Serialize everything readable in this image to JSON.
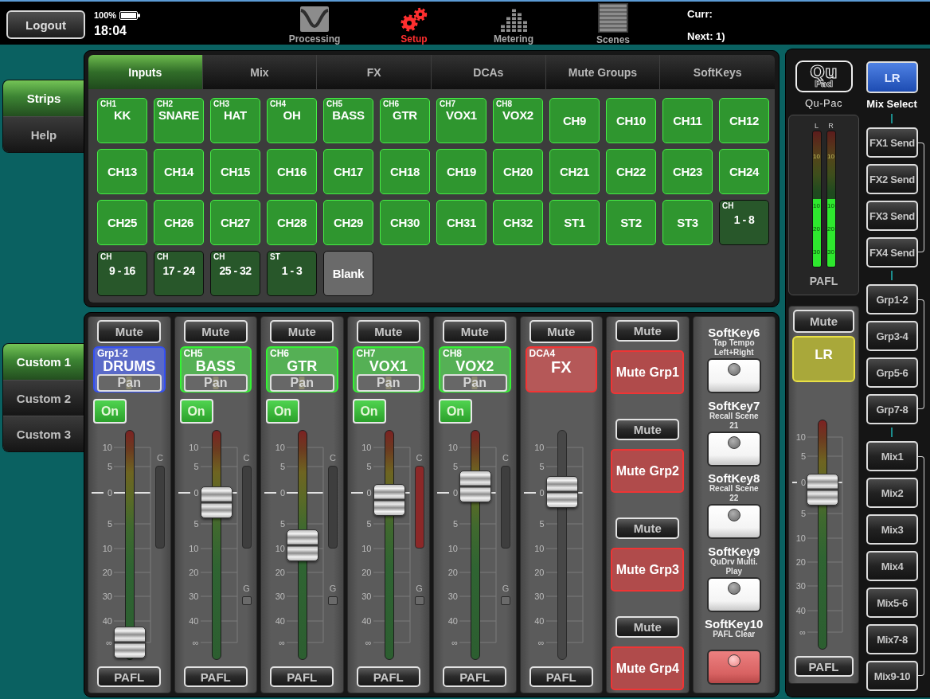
{
  "top_bar": {
    "logout": "Logout",
    "battery": "100%",
    "time": "18:04",
    "nav": [
      {
        "kind": "processing",
        "label": "Processing",
        "selected": false
      },
      {
        "kind": "setup",
        "label": "Setup",
        "selected": true
      },
      {
        "kind": "metering",
        "label": "Metering",
        "selected": false
      },
      {
        "kind": "scenes",
        "label": "Scenes",
        "selected": false
      }
    ],
    "current_scene": "Curr:",
    "next_scene": "Next: 1)"
  },
  "view_tabs": [
    {
      "label": "Strips",
      "selected": true
    },
    {
      "label": "Help",
      "selected": false
    }
  ],
  "layer_tabs": [
    {
      "label": "Custom 1",
      "selected": true
    },
    {
      "label": "Custom 2",
      "selected": false
    },
    {
      "label": "Custom 3",
      "selected": false
    }
  ],
  "setup_tabs": [
    {
      "label": "Inputs",
      "selected": true
    },
    {
      "label": "Mix",
      "selected": false
    },
    {
      "label": "FX",
      "selected": false
    },
    {
      "label": "DCAs",
      "selected": false
    },
    {
      "label": "Mute Groups",
      "selected": false
    },
    {
      "label": "SoftKeys",
      "selected": false
    }
  ],
  "inputs": [
    {
      "kind": "channel",
      "tag": "CH1",
      "name": "KK"
    },
    {
      "kind": "channel",
      "tag": "CH2",
      "name": "SNARE"
    },
    {
      "kind": "channel",
      "tag": "CH3",
      "name": "HAT"
    },
    {
      "kind": "channel",
      "tag": "CH4",
      "name": "OH"
    },
    {
      "kind": "channel",
      "tag": "CH5",
      "name": "BASS"
    },
    {
      "kind": "channel",
      "tag": "CH6",
      "name": "GTR"
    },
    {
      "kind": "channel",
      "tag": "CH7",
      "name": "VOX1"
    },
    {
      "kind": "channel",
      "tag": "CH8",
      "name": "VOX2"
    },
    {
      "kind": "channel",
      "name": "CH9"
    },
    {
      "kind": "channel",
      "name": "CH10"
    },
    {
      "kind": "channel",
      "name": "CH11"
    },
    {
      "kind": "channel",
      "name": "CH12"
    },
    {
      "kind": "channel",
      "name": "CH13"
    },
    {
      "kind": "channel",
      "name": "CH14"
    },
    {
      "kind": "channel",
      "name": "CH15"
    },
    {
      "kind": "channel",
      "name": "CH16"
    },
    {
      "kind": "channel",
      "name": "CH17"
    },
    {
      "kind": "channel",
      "name": "CH18"
    },
    {
      "kind": "channel",
      "name": "CH19"
    },
    {
      "kind": "channel",
      "name": "CH20"
    },
    {
      "kind": "channel",
      "name": "CH21"
    },
    {
      "kind": "channel",
      "name": "CH22"
    },
    {
      "kind": "channel",
      "name": "CH23"
    },
    {
      "kind": "channel",
      "name": "CH24"
    },
    {
      "kind": "channel",
      "name": "CH25"
    },
    {
      "kind": "channel",
      "name": "CH26"
    },
    {
      "kind": "channel",
      "name": "CH27"
    },
    {
      "kind": "channel",
      "name": "CH28"
    },
    {
      "kind": "channel",
      "name": "CH29"
    },
    {
      "kind": "channel",
      "name": "CH30"
    },
    {
      "kind": "channel",
      "name": "CH31"
    },
    {
      "kind": "channel",
      "name": "CH32"
    },
    {
      "kind": "channel",
      "name": "ST1"
    },
    {
      "kind": "channel",
      "name": "ST2"
    },
    {
      "kind": "channel",
      "name": "ST3"
    },
    {
      "kind": "bank",
      "tag": "CH",
      "name": "1 - 8"
    },
    {
      "kind": "bank",
      "tag": "CH",
      "name": "9 - 16"
    },
    {
      "kind": "bank",
      "tag": "CH",
      "name": "17 - 24"
    },
    {
      "kind": "bank",
      "tag": "CH",
      "name": "25 - 32"
    },
    {
      "kind": "bank",
      "tag": "ST",
      "name": "1 - 3"
    },
    {
      "kind": "blank",
      "name": "Blank"
    }
  ],
  "strips": [
    {
      "kind": "channel",
      "mute": "Mute",
      "muted": false,
      "tag": "Grp1-2",
      "name": "DRUMS",
      "color": "#5a6ac8",
      "pan": {
        "label": "Pan",
        "level": 0.5
      },
      "on_button": {
        "label": "On",
        "on": true
      },
      "fader": {
        "level": 0,
        "scale": [
          "10",
          "5",
          "0",
          "5",
          "10",
          "20",
          "30",
          "40",
          "∞"
        ]
      },
      "comp": {
        "label": "C",
        "active": false
      },
      "pafl": "PAFL"
    },
    {
      "kind": "channel",
      "mute": "Mute",
      "muted": false,
      "tag": "CH5",
      "name": "BASS",
      "color": "#55b055",
      "pan": {
        "label": "Pan",
        "level": 0.5
      },
      "on_button": {
        "label": "On",
        "on": true
      },
      "fader": {
        "level": 0.72,
        "scale": [
          "10",
          "5",
          "0",
          "5",
          "10",
          "20",
          "30",
          "40",
          "∞"
        ]
      },
      "comp": {
        "label": "C",
        "active": false
      },
      "gate": "G",
      "pafl": "PAFL"
    },
    {
      "kind": "channel",
      "mute": "Mute",
      "muted": false,
      "tag": "CH6",
      "name": "GTR",
      "color": "#55b055",
      "pan": {
        "label": "Pan",
        "level": 0.5
      },
      "on_button": {
        "label": "On",
        "on": true
      },
      "fader": {
        "level": 0.5,
        "scale": [
          "10",
          "5",
          "0",
          "5",
          "10",
          "20",
          "30",
          "40",
          "∞"
        ]
      },
      "comp": {
        "label": "C",
        "active": false
      },
      "gate": "G",
      "pafl": "PAFL"
    },
    {
      "kind": "channel",
      "mute": "Mute",
      "muted": false,
      "tag": "CH7",
      "name": "VOX1",
      "color": "#55b055",
      "pan": {
        "label": "Pan",
        "level": 0.5
      },
      "on_button": {
        "label": "On",
        "on": true
      },
      "fader": {
        "level": 0.73,
        "scale": [
          "10",
          "5",
          "0",
          "5",
          "10",
          "20",
          "30",
          "40",
          "∞"
        ]
      },
      "comp": {
        "label": "C",
        "active": true
      },
      "gate": "G",
      "pafl": "PAFL"
    },
    {
      "kind": "channel",
      "mute": "Mute",
      "muted": false,
      "tag": "CH8",
      "name": "VOX2",
      "color": "#55b055",
      "pan": {
        "label": "Pan",
        "level": 0.5
      },
      "on_button": {
        "label": "On",
        "on": true
      },
      "fader": {
        "level": 0.8,
        "scale": [
          "10",
          "5",
          "0",
          "5",
          "10",
          "20",
          "30",
          "40",
          "∞"
        ]
      },
      "comp": {
        "label": "C",
        "active": false
      },
      "gate": "G",
      "pafl": "PAFL"
    },
    {
      "kind": "dca",
      "mute": "Mute",
      "muted": false,
      "tag": "DCA4",
      "name": "FX",
      "color": "#b55858",
      "fader": {
        "level": 0.77,
        "scale": [
          "10",
          "5",
          "0",
          "5",
          "10",
          "20",
          "30",
          "40",
          "∞"
        ]
      },
      "pafl": "PAFL"
    }
  ],
  "mute_groups": [
    {
      "mute": "Mute",
      "muted": false,
      "label": "Mute Grp1"
    },
    {
      "mute": "Mute",
      "muted": false,
      "label": "Mute Grp2"
    },
    {
      "mute": "Mute",
      "muted": false,
      "label": "Mute Grp3"
    },
    {
      "mute": "Mute",
      "muted": false,
      "label": "Mute Grp4"
    }
  ],
  "softkeys": [
    {
      "name": "SoftKey6",
      "action": "Tap Tempo Left+Right",
      "lit": false
    },
    {
      "name": "SoftKey7",
      "action": "Recall Scene 21",
      "lit": false
    },
    {
      "name": "SoftKey8",
      "action": "Recall Scene 22",
      "lit": false
    },
    {
      "name": "SoftKey9",
      "action": "QuDrv Multi. Play",
      "lit": false
    },
    {
      "name": "SoftKey10",
      "action": "PAFL Clear",
      "lit": true
    }
  ],
  "master": {
    "logo_top": "Qu",
    "logo_bottom": "Pad",
    "model": "Qu-Pac",
    "meters": [
      {
        "label": "L",
        "level": 0.5,
        "scale": [
          "10",
          "10",
          "20",
          "30"
        ]
      },
      {
        "label": "R",
        "level": 0.5,
        "scale": [
          "10",
          "10",
          "20",
          "30"
        ]
      }
    ],
    "meter_label": "PAFL",
    "mute": "Mute",
    "muted": false,
    "name": "LR",
    "fader": {
      "level": 0.73,
      "scale": [
        "10",
        "5",
        "0",
        "5",
        "10",
        "20",
        "30",
        "40",
        "∞"
      ]
    },
    "pafl": "PAFL"
  },
  "mix_select": {
    "master": {
      "label": "LR",
      "selected": true
    },
    "title": "Mix Select",
    "groups": [
      {
        "buttons": [
          {
            "label": "FX1 Send",
            "selected": false
          },
          {
            "label": "FX2 Send",
            "selected": false
          },
          {
            "label": "FX3 Send",
            "selected": false
          },
          {
            "label": "FX4 Send",
            "selected": false
          }
        ]
      },
      {
        "buttons": [
          {
            "label": "Grp1-2",
            "selected": false
          },
          {
            "label": "Grp3-4",
            "selected": false
          },
          {
            "label": "Grp5-6",
            "selected": false
          },
          {
            "label": "Grp7-8",
            "selected": false
          }
        ]
      },
      {
        "buttons": [
          {
            "label": "Mix1",
            "selected": false
          },
          {
            "label": "Mix2",
            "selected": false
          },
          {
            "label": "Mix3",
            "selected": false
          },
          {
            "label": "Mix4",
            "selected": false
          },
          {
            "label": "Mix5-6",
            "selected": false
          },
          {
            "label": "Mix7-8",
            "selected": false
          },
          {
            "label": "Mix9-10",
            "selected": false
          }
        ]
      }
    ]
  }
}
